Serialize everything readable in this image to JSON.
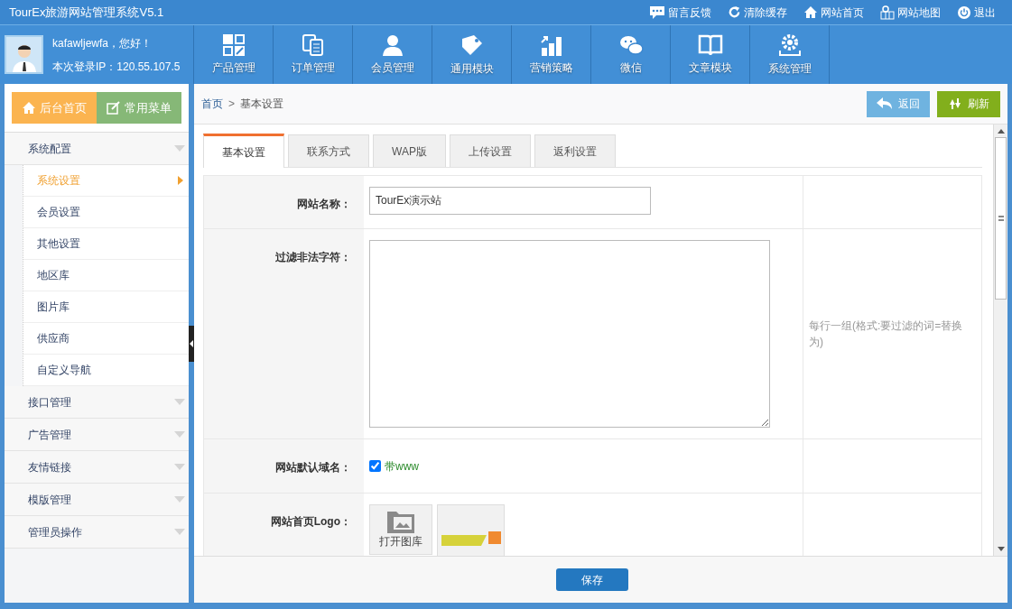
{
  "app_title": "TourEx旅游网站管理系统V5.1",
  "top_links": [
    {
      "label": "留言反馈"
    },
    {
      "label": "清除缓存"
    },
    {
      "label": "网站首页"
    },
    {
      "label": "网站地图"
    },
    {
      "label": "退出"
    }
  ],
  "user": {
    "greeting": "kafawljewfa，您好！",
    "login_ip": "本次登录IP：120.55.107.5"
  },
  "modules": [
    {
      "label": "产品管理"
    },
    {
      "label": "订单管理"
    },
    {
      "label": "会员管理"
    },
    {
      "label": "通用模块"
    },
    {
      "label": "营销策略"
    },
    {
      "label": "微信"
    },
    {
      "label": "文章模块"
    },
    {
      "label": "系统管理"
    }
  ],
  "sidebar": {
    "quick_buttons": [
      {
        "label": "后台首页",
        "kind": "home"
      },
      {
        "label": "常用菜单",
        "kind": "menu"
      }
    ],
    "groups": [
      {
        "label": "系统配置",
        "expanded": true,
        "children": [
          {
            "label": "系统设置",
            "selected": true
          },
          {
            "label": "会员设置",
            "selected": false
          },
          {
            "label": "其他设置",
            "selected": false
          },
          {
            "label": "地区库",
            "selected": false
          },
          {
            "label": "图片库",
            "selected": false
          },
          {
            "label": "供应商",
            "selected": false
          },
          {
            "label": "自定义导航",
            "selected": false
          }
        ]
      },
      {
        "label": "接口管理"
      },
      {
        "label": "广告管理"
      },
      {
        "label": "友情链接"
      },
      {
        "label": "模版管理"
      },
      {
        "label": "管理员操作"
      }
    ]
  },
  "breadcrumb": {
    "home": "首页",
    "separator": ">",
    "current": "基本设置"
  },
  "actions": [
    {
      "label": "返回",
      "kind": "back"
    },
    {
      "label": "刷新",
      "kind": "refresh"
    }
  ],
  "tabs": [
    {
      "label": "基本设置",
      "selected": true
    },
    {
      "label": "联系方式",
      "selected": false
    },
    {
      "label": "WAP版",
      "selected": false
    },
    {
      "label": "上传设置",
      "selected": false
    },
    {
      "label": "返利设置",
      "selected": false
    }
  ],
  "form_rows": [
    {
      "kind": "text",
      "label": "网站名称：",
      "value": "TourEx演示站"
    },
    {
      "kind": "textarea",
      "label": "过滤非法字符：",
      "value": "",
      "hint": "每行一组(格式:要过滤的词=替换为)"
    },
    {
      "kind": "checkbox",
      "label": "网站默认域名：",
      "option": "带www",
      "checked": true
    },
    {
      "kind": "images",
      "label": "网站首页Logo：",
      "picker": "打开图库"
    }
  ],
  "save_button": "保存"
}
